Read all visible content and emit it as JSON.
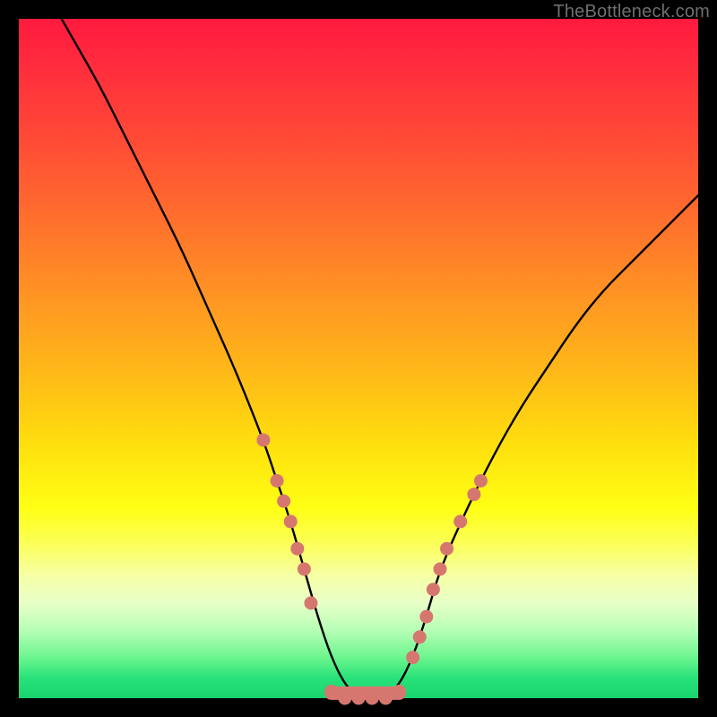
{
  "watermark": "TheBottleneck.com",
  "colors": {
    "curve_stroke": "#000000",
    "dot_fill": "#d6776f",
    "background_frame": "#000000"
  },
  "chart_data": {
    "type": "line",
    "title": "",
    "xlabel": "",
    "ylabel": "",
    "xlim": [
      0,
      100
    ],
    "ylim": [
      0,
      100
    ],
    "grid": false,
    "legend": false,
    "series": [
      {
        "name": "bottleneck-curve",
        "x": [
          0,
          4,
          8,
          12,
          16,
          20,
          24,
          28,
          32,
          36,
          38,
          40,
          42,
          44,
          46,
          48,
          50,
          52,
          54,
          56,
          58,
          60,
          62,
          66,
          70,
          74,
          78,
          82,
          86,
          90,
          94,
          98,
          100
        ],
        "y": [
          110,
          104,
          97,
          90,
          82,
          74,
          66,
          57,
          48,
          38,
          32,
          26,
          19,
          12,
          6,
          2,
          0,
          0,
          0,
          2,
          6,
          12,
          19,
          28,
          36,
          43,
          49,
          55,
          60,
          64,
          68,
          72,
          74
        ]
      }
    ],
    "annotations": {
      "dots_left": [
        {
          "x": 36,
          "y": 38
        },
        {
          "x": 38,
          "y": 32
        },
        {
          "x": 39,
          "y": 29
        },
        {
          "x": 40,
          "y": 26
        },
        {
          "x": 41,
          "y": 22
        },
        {
          "x": 42,
          "y": 19
        },
        {
          "x": 43,
          "y": 14
        }
      ],
      "dots_right": [
        {
          "x": 58,
          "y": 6
        },
        {
          "x": 59,
          "y": 9
        },
        {
          "x": 60,
          "y": 12
        },
        {
          "x": 61,
          "y": 16
        },
        {
          "x": 62,
          "y": 19
        },
        {
          "x": 63,
          "y": 22
        },
        {
          "x": 65,
          "y": 26
        },
        {
          "x": 67,
          "y": 30
        },
        {
          "x": 68,
          "y": 32
        }
      ],
      "dots_bottom": [
        {
          "x": 46,
          "y": 1
        },
        {
          "x": 48,
          "y": 0
        },
        {
          "x": 50,
          "y": 0
        },
        {
          "x": 52,
          "y": 0
        },
        {
          "x": 54,
          "y": 0
        },
        {
          "x": 56,
          "y": 1
        }
      ]
    }
  }
}
